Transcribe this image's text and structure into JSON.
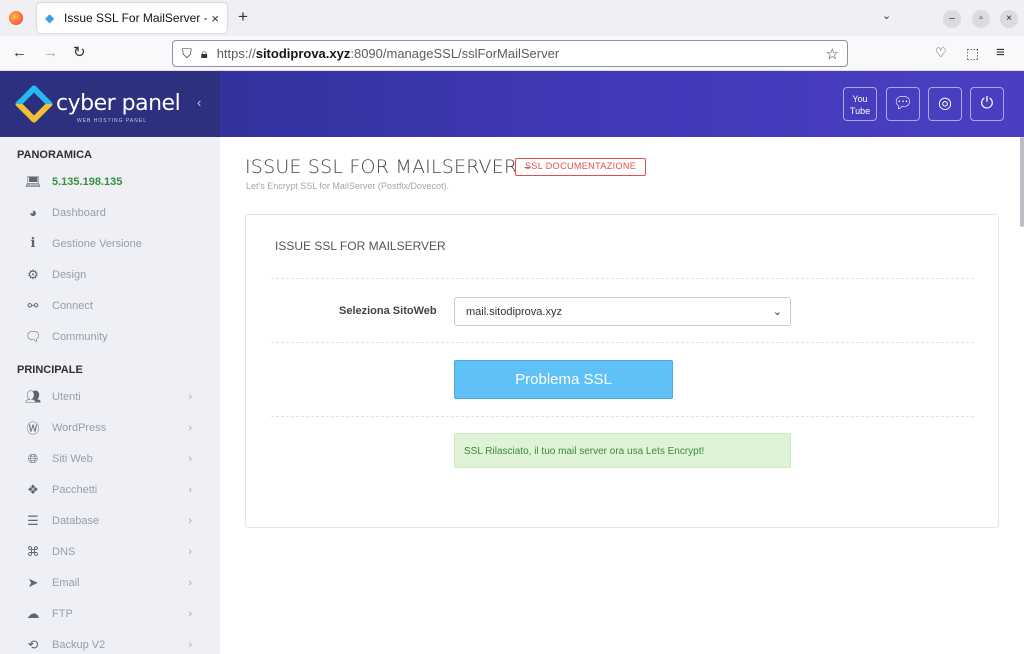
{
  "browser": {
    "tab_title": "Issue SSL For MailServer -",
    "tab_close": "×",
    "new_tab": "+",
    "url_host": "sitodiprova.xyz",
    "url_prefix": "https://",
    "url_suffix": ":8090/manageSSL/sslForMailServer"
  },
  "brand": {
    "name": "cyber panel",
    "tagline": "WEB HOSTING PANEL"
  },
  "topbar_icons": [
    "youtube-icon",
    "chat-icon",
    "support-icon",
    "power-icon"
  ],
  "sidebar": {
    "section1": "PANORAMICA",
    "ip": "5.135.198.135",
    "items1": [
      {
        "label": "Dashboard",
        "icon": "dashboard-icon"
      },
      {
        "label": "Gestione Versione",
        "icon": "info-icon"
      },
      {
        "label": "Design",
        "icon": "gear-icon"
      },
      {
        "label": "Connect",
        "icon": "link-icon"
      },
      {
        "label": "Community",
        "icon": "comments-icon"
      }
    ],
    "section2": "PRINCIPALE",
    "items2": [
      {
        "label": "Utenti",
        "icon": "users-icon"
      },
      {
        "label": "WordPress",
        "icon": "wordpress-icon"
      },
      {
        "label": "Siti Web",
        "icon": "globe-icon"
      },
      {
        "label": "Pacchetti",
        "icon": "packages-icon"
      },
      {
        "label": "Database",
        "icon": "database-icon"
      },
      {
        "label": "DNS",
        "icon": "sitemap-icon"
      },
      {
        "label": "Email",
        "icon": "paper-plane-icon"
      },
      {
        "label": "FTP",
        "icon": "cloud-upload-icon"
      },
      {
        "label": "Backup V2",
        "icon": "backup-icon"
      }
    ]
  },
  "main": {
    "title": "ISSUE SSL FOR MAILSERVER -",
    "doc_badge": "SSL DOCUMENTAZIONE",
    "subtitle": "Let's Encrypt SSL for MailServer (Postfix/Dovecot).",
    "card_title": "ISSUE SSL FOR MAILSERVER",
    "field_label": "Seleziona SitoWeb",
    "selected_site": "mail.sitodiprova.xyz",
    "button_label": "Problema SSL",
    "alert_text": "SSL Rilasciato, il tuo mail server ora usa Lets Encrypt!"
  }
}
